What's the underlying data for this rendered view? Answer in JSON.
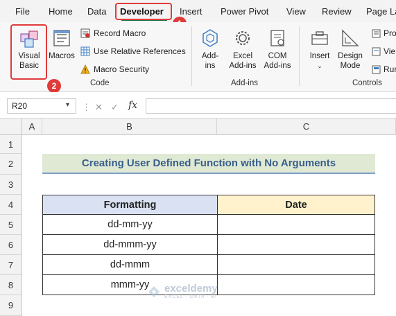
{
  "menu": {
    "items": [
      "File",
      "Home",
      "Data",
      "Developer",
      "Insert",
      "Power Pivot",
      "View",
      "Review",
      "Page La"
    ],
    "active": "Developer"
  },
  "callouts": {
    "first": "1",
    "second": "2"
  },
  "ribbon": {
    "code_group": {
      "label": "Code",
      "visual_basic": "Visual Basic",
      "macros": "Macros",
      "record_macro": "Record Macro",
      "relative_refs": "Use Relative References",
      "macro_security": "Macro Security"
    },
    "addins_group": {
      "label": "Add-ins",
      "addins": "Add-ins",
      "excel_addins": "Excel Add-ins",
      "com_addins": "COM Add-ins"
    },
    "controls_group": {
      "label": "Controls",
      "insert": "Insert",
      "design_mode": "Design Mode",
      "properties": "Pro",
      "view_code": "Vie",
      "run_dialog": "Rur"
    }
  },
  "formula_bar": {
    "name_box": "R20",
    "fx": "fx",
    "formula": ""
  },
  "sheet": {
    "columns": [
      "A",
      "B",
      "C"
    ],
    "rows": [
      "1",
      "2",
      "3",
      "4",
      "5",
      "6",
      "7",
      "8",
      "9"
    ],
    "title": "Creating User Defined Function with No Arguments",
    "table": {
      "headers": [
        "Formatting",
        "Date"
      ],
      "rows": [
        [
          "dd-mm-yy",
          ""
        ],
        [
          "dd-mmm-yy",
          ""
        ],
        [
          "dd-mmm",
          ""
        ],
        [
          "mmm-yy",
          ""
        ]
      ]
    }
  },
  "watermark": {
    "title": "exceldemy",
    "subtitle": "EXCEL · DATA · BI"
  },
  "colors": {
    "accent_green": "#1e7145",
    "callout_red": "#e03b3b",
    "title_fill": "#dfe9d3",
    "formatting_header_fill": "#d9e1f2",
    "date_header_fill": "#fff2cc"
  }
}
